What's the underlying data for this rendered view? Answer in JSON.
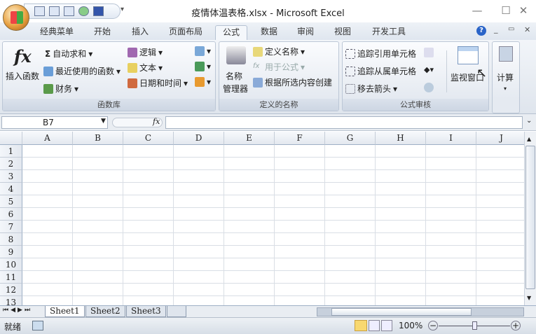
{
  "window": {
    "title": "疫情体温表格.xlsx - Microsoft Excel",
    "minimize": "—",
    "maximize": "☐",
    "close": "✕"
  },
  "qat": {
    "dropdown": "▾"
  },
  "tabs": [
    "经典菜单",
    "开始",
    "插入",
    "页面布局",
    "公式",
    "数据",
    "审阅",
    "视图",
    "开发工具"
  ],
  "active_tab": "公式",
  "ribbon": {
    "function_library": {
      "label": "函数库",
      "insert_function": "插入函数",
      "fx": "fx",
      "autosum": "自动求和",
      "recent": "最近使用的函数",
      "financial": "财务",
      "logical": "逻辑",
      "text": "文本",
      "datetime": "日期和时间"
    },
    "defined_names": {
      "label": "定义的名称",
      "name_manager_1": "名称",
      "name_manager_2": "管理器",
      "define_name": "定义名称",
      "use_in_formula": "用于公式",
      "create_from_selection": "根据所选内容创建"
    },
    "formula_auditing": {
      "label": "公式审核",
      "trace_precedents": "追踪引用单元格",
      "trace_dependents": "追踪从属单元格",
      "remove_arrows": "移去箭头",
      "watch_window": "监视窗口"
    },
    "calculation": {
      "label": "计算"
    }
  },
  "formula_bar": {
    "name_box": "B7",
    "fx": "fx",
    "value": ""
  },
  "columns": [
    "A",
    "B",
    "C",
    "D",
    "E",
    "F",
    "G",
    "H",
    "I",
    "J"
  ],
  "rows": [
    "1",
    "2",
    "3",
    "4",
    "5",
    "6",
    "7",
    "8",
    "9",
    "10",
    "11",
    "12",
    "13"
  ],
  "sheets": [
    "Sheet1",
    "Sheet2",
    "Sheet3"
  ],
  "active_sheet": "Sheet1",
  "status": {
    "ready": "就绪",
    "zoom": "100%",
    "zoom_fraction": 0.5
  }
}
